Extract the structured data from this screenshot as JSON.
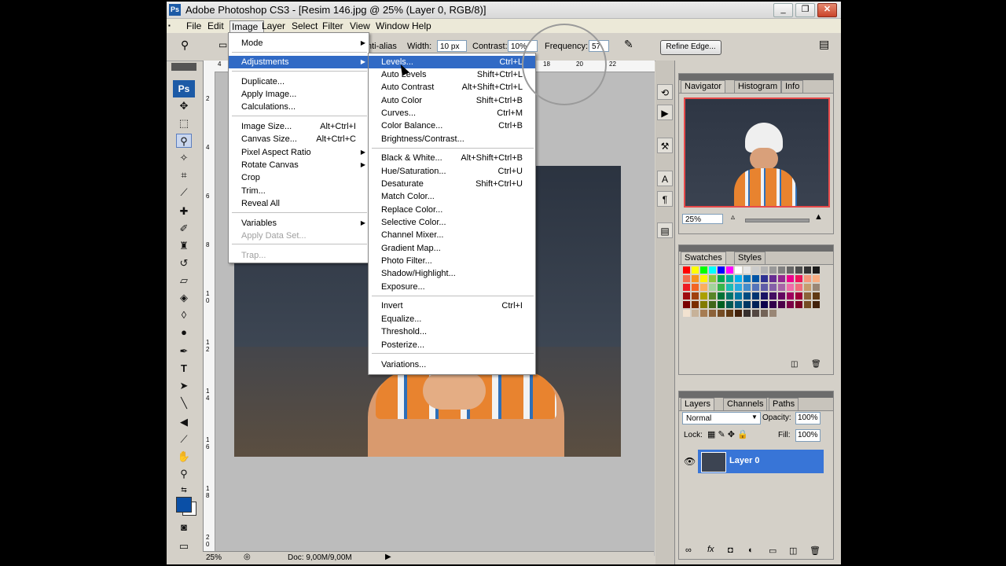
{
  "window": {
    "title": "Adobe Photoshop CS3 - [Resim 146.jpg @ 25% (Layer 0, RGB/8)]",
    "min": "_",
    "restore": "❐",
    "close": "✕"
  },
  "menubar": [
    "File",
    "Edit",
    "Image",
    "Layer",
    "Select",
    "Filter",
    "View",
    "Window",
    "Help"
  ],
  "options": {
    "antialias": "nti-alias",
    "width_label": "Width:",
    "width_value": "10 px",
    "contrast_label": "Contrast:",
    "contrast_value": "10%",
    "frequency_label": "Frequency:",
    "frequency_value": "57",
    "refine_edge": "Refine Edge..."
  },
  "image_menu": [
    {
      "label": "Mode",
      "arrow": true
    },
    {
      "label": "Adjustments",
      "arrow": true,
      "highlight": true
    },
    {
      "label": "Duplicate..."
    },
    {
      "label": "Apply Image..."
    },
    {
      "label": "Calculations..."
    },
    {
      "label": "Image Size...",
      "shortcut": "Alt+Ctrl+I"
    },
    {
      "label": "Canvas Size...",
      "shortcut": "Alt+Ctrl+C"
    },
    {
      "label": "Pixel Aspect Ratio",
      "arrow": true
    },
    {
      "label": "Rotate Canvas",
      "arrow": true
    },
    {
      "label": "Crop"
    },
    {
      "label": "Trim..."
    },
    {
      "label": "Reveal All"
    },
    {
      "label": "Variables",
      "arrow": true
    },
    {
      "label": "Apply Data Set...",
      "disabled": true
    },
    {
      "label": "Trap...",
      "disabled": true
    }
  ],
  "adjustments_menu": [
    {
      "label": "Levels...",
      "shortcut": "Ctrl+L",
      "highlight": true
    },
    {
      "label": "Auto Levels",
      "shortcut": "Shift+Ctrl+L"
    },
    {
      "label": "Auto Contrast",
      "shortcut": "Alt+Shift+Ctrl+L"
    },
    {
      "label": "Auto Color",
      "shortcut": "Shift+Ctrl+B"
    },
    {
      "label": "Curves...",
      "shortcut": "Ctrl+M"
    },
    {
      "label": "Color Balance...",
      "shortcut": "Ctrl+B"
    },
    {
      "label": "Brightness/Contrast..."
    },
    {
      "label": "Black & White...",
      "shortcut": "Alt+Shift+Ctrl+B"
    },
    {
      "label": "Hue/Saturation...",
      "shortcut": "Ctrl+U"
    },
    {
      "label": "Desaturate",
      "shortcut": "Shift+Ctrl+U"
    },
    {
      "label": "Match Color..."
    },
    {
      "label": "Replace Color..."
    },
    {
      "label": "Selective Color..."
    },
    {
      "label": "Channel Mixer..."
    },
    {
      "label": "Gradient Map..."
    },
    {
      "label": "Photo Filter..."
    },
    {
      "label": "Shadow/Highlight..."
    },
    {
      "label": "Exposure..."
    },
    {
      "label": "Invert",
      "shortcut": "Ctrl+I"
    },
    {
      "label": "Equalize..."
    },
    {
      "label": "Threshold..."
    },
    {
      "label": "Posterize..."
    },
    {
      "label": "Variations..."
    }
  ],
  "toolbox": {
    "logo": "Ps"
  },
  "ruler_h": [
    "4",
    "6",
    "8",
    "18",
    "20",
    "22"
  ],
  "ruler_v": [
    "2",
    "4",
    "6",
    "8",
    "1 0",
    "1 2",
    "1 4",
    "1 6",
    "1 8",
    "2 0"
  ],
  "status": {
    "zoom": "25%",
    "doc": "Doc: 9,00M/9,00M"
  },
  "navigator": {
    "tabs": [
      "Navigator",
      "Histogram",
      "Info"
    ],
    "zoom": "25%"
  },
  "swatches": {
    "tabs": [
      "Swatches",
      "Styles"
    ],
    "colors": [
      "#ff0000",
      "#ffff00",
      "#00ff00",
      "#00ffff",
      "#0000ff",
      "#ff00ff",
      "#ffffff",
      "#e6e6e6",
      "#cccccc",
      "#b3b3b3",
      "#999999",
      "#808080",
      "#666666",
      "#4d4d4d",
      "#333333",
      "#1a1a1a",
      "#f26c4f",
      "#f7941d",
      "#fff200",
      "#8dc63f",
      "#00a651",
      "#00a99d",
      "#00aeef",
      "#0072bc",
      "#0054a6",
      "#2e3192",
      "#662d91",
      "#92278f",
      "#ec008c",
      "#ed145b",
      "#f69679",
      "#f9ad81",
      "#ed1c24",
      "#f26522",
      "#fbaf5d",
      "#a3d39c",
      "#39b54a",
      "#1cbbb4",
      "#27aae1",
      "#448ccb",
      "#5574b9",
      "#605ca8",
      "#8560a8",
      "#a864a8",
      "#f06eaa",
      "#f26d7d",
      "#c69c6d",
      "#998675",
      "#9e0b0f",
      "#a0410d",
      "#aba000",
      "#598527",
      "#007236",
      "#00746b",
      "#0076a3",
      "#004b80",
      "#003471",
      "#1b1464",
      "#440e62",
      "#630460",
      "#9e005d",
      "#9e0039",
      "#8c6239",
      "#603913",
      "#790000",
      "#7b2e00",
      "#827b00",
      "#406618",
      "#005e20",
      "#005952",
      "#005b7f",
      "#003663",
      "#002157",
      "#0d004c",
      "#32004b",
      "#4b0049",
      "#7b0046",
      "#7a0026",
      "#754c24",
      "#42210b",
      "#f2e2d0",
      "#c7b299",
      "#a67c52",
      "#8c6239",
      "#754c24",
      "#603913",
      "#42210b",
      "#362f2d",
      "#534741",
      "#736357",
      "#998675"
    ]
  },
  "layers": {
    "tabs": [
      "Layers",
      "Channels",
      "Paths"
    ],
    "blend": "Normal",
    "opacity_label": "Opacity:",
    "opacity": "100%",
    "lock_label": "Lock:",
    "fill_label": "Fill:",
    "fill": "100%",
    "layer_name": "Layer 0"
  }
}
